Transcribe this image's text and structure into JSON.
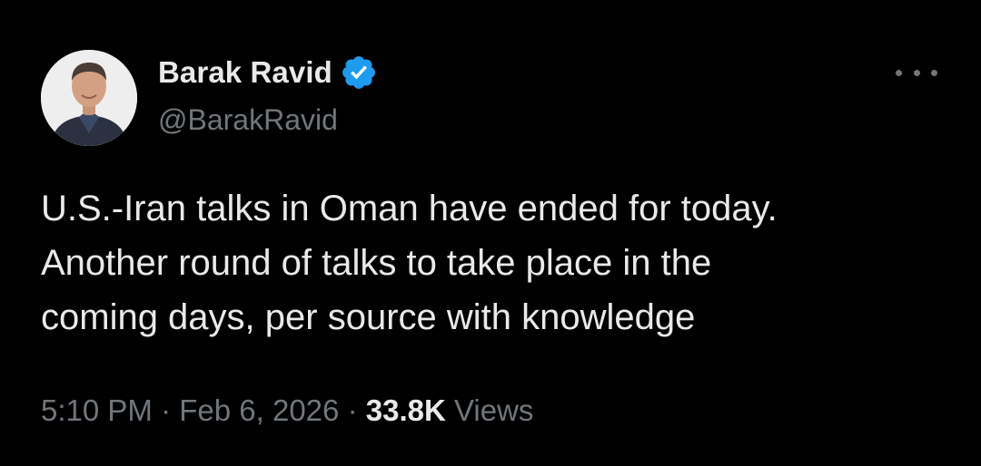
{
  "author": {
    "display_name": "Barak Ravid",
    "handle": "@BarakRavid",
    "verified": true,
    "avatar_icon": "profile-photo"
  },
  "tweet": {
    "text": "U.S.-Iran talks in Oman have ended for today.\nAnother round of talks to take place in the\ncoming days, per source with knowledge"
  },
  "meta": {
    "time": "5:10 PM",
    "separator": "·",
    "date": "Feb 6, 2026",
    "views_count": "33.8K",
    "views_label": "Views"
  },
  "colors": {
    "background": "#000000",
    "primary_text": "#e7e9ea",
    "secondary_text": "#71767b",
    "verified_badge": "#1d9bf0"
  },
  "icons": {
    "more": "more-horizontal-icon",
    "verified": "verified-badge-icon"
  }
}
